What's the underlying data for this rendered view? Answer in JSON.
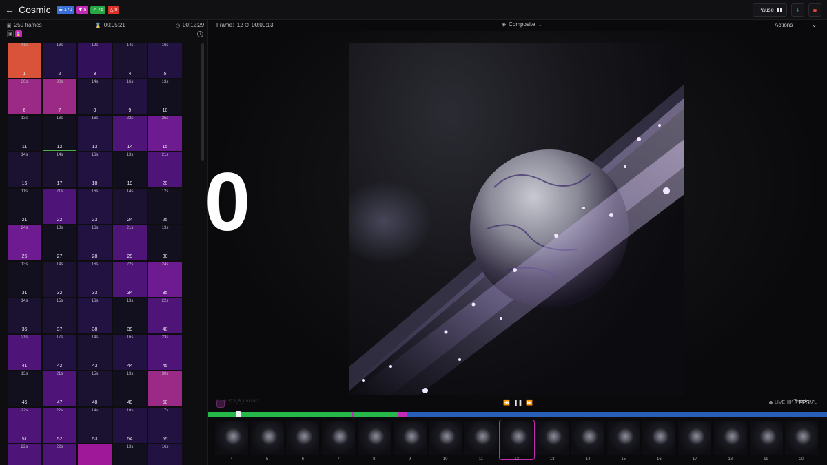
{
  "header": {
    "back_icon": "arrow-left-icon",
    "title": "Cosmic",
    "badges": [
      {
        "icon": "list-icon",
        "value": "170",
        "color": "#3a6fd8"
      },
      {
        "icon": "running-icon",
        "value": "5",
        "color": "#c42bb4"
      },
      {
        "icon": "check-icon",
        "value": "75",
        "color": "#28a745"
      },
      {
        "icon": "warning-icon",
        "value": "0",
        "color": "#d9342b"
      }
    ],
    "pause_label": "Pause",
    "download_icon": "download-icon",
    "delete_icon": "trash-icon"
  },
  "left": {
    "frames_label": "250 frames",
    "elapsed": "00:05:21",
    "remaining": "00:12:29",
    "cells": [
      {
        "n": "1",
        "d": "41s"
      },
      {
        "n": "2",
        "d": "18s"
      },
      {
        "n": "3",
        "d": "19s"
      },
      {
        "n": "4",
        "d": "14s"
      },
      {
        "n": "5",
        "d": "16s"
      },
      {
        "n": "6",
        "d": "30s"
      },
      {
        "n": "7",
        "d": "30s"
      },
      {
        "n": "8",
        "d": "14s"
      },
      {
        "n": "9",
        "d": "16s"
      },
      {
        "n": "10",
        "d": "13s"
      },
      {
        "n": "11",
        "d": "13s"
      },
      {
        "n": "12",
        "d": "13s"
      },
      {
        "n": "13",
        "d": "16s"
      },
      {
        "n": "14",
        "d": "22s"
      },
      {
        "n": "15",
        "d": "25s"
      },
      {
        "n": "16",
        "d": "14s"
      },
      {
        "n": "17",
        "d": "14s"
      },
      {
        "n": "18",
        "d": "16s"
      },
      {
        "n": "19",
        "d": "13s"
      },
      {
        "n": "20",
        "d": "21s"
      },
      {
        "n": "21",
        "d": "11s"
      },
      {
        "n": "22",
        "d": "21s"
      },
      {
        "n": "23",
        "d": "16s"
      },
      {
        "n": "24",
        "d": "14s"
      },
      {
        "n": "25",
        "d": "12s"
      },
      {
        "n": "26",
        "d": "24s"
      },
      {
        "n": "27",
        "d": "13s"
      },
      {
        "n": "28",
        "d": "16s"
      },
      {
        "n": "29",
        "d": "21s"
      },
      {
        "n": "30",
        "d": "13s"
      },
      {
        "n": "31",
        "d": "13s"
      },
      {
        "n": "32",
        "d": "14s"
      },
      {
        "n": "33",
        "d": "16s"
      },
      {
        "n": "34",
        "d": "22s"
      },
      {
        "n": "35",
        "d": "24s"
      },
      {
        "n": "36",
        "d": "14s"
      },
      {
        "n": "37",
        "d": "15s"
      },
      {
        "n": "38",
        "d": "16s"
      },
      {
        "n": "39",
        "d": "13s"
      },
      {
        "n": "40",
        "d": "22s"
      },
      {
        "n": "41",
        "d": "21s"
      },
      {
        "n": "42",
        "d": "17s"
      },
      {
        "n": "43",
        "d": "14s"
      },
      {
        "n": "44",
        "d": "16s"
      },
      {
        "n": "45",
        "d": "23s"
      },
      {
        "n": "46",
        "d": "13s"
      },
      {
        "n": "47",
        "d": "21s"
      },
      {
        "n": "48",
        "d": "15s"
      },
      {
        "n": "49",
        "d": "13s"
      },
      {
        "n": "50",
        "d": "30s"
      },
      {
        "n": "51",
        "d": "22s"
      },
      {
        "n": "52",
        "d": "22s"
      },
      {
        "n": "53",
        "d": "14s"
      },
      {
        "n": "54",
        "d": "16s"
      },
      {
        "n": "55",
        "d": "17s"
      },
      {
        "n": "",
        "d": "22s"
      },
      {
        "n": "",
        "d": "22s"
      },
      {
        "n": "",
        "d": ""
      },
      {
        "n": "",
        "d": "13s"
      },
      {
        "n": "",
        "d": "16s"
      }
    ],
    "selected_frame": "12"
  },
  "overlay": {
    "big_number": "0"
  },
  "viewer": {
    "frame_label": "Frame:",
    "frame_value": "12",
    "frame_time": "00:00:13",
    "view_mode": "Composite",
    "actions_label": "Actions",
    "hint_text": "Hash: 57S_B_C9Y0KJ",
    "task_logs_label": "Task Logs",
    "live_label": "LIVE",
    "fps_label": "15 FPS"
  },
  "timeline": {
    "playhead_fraction": 0.048,
    "segments": [
      {
        "from": 0.0,
        "to": 0.233,
        "color": "#27b84a"
      },
      {
        "from": 0.233,
        "to": 0.236,
        "color": "#c42bb4"
      },
      {
        "from": 0.236,
        "to": 0.307,
        "color": "#27b84a"
      },
      {
        "from": 0.307,
        "to": 0.322,
        "color": "#c42bb4"
      }
    ]
  },
  "strip": {
    "frames": [
      "4",
      "5",
      "6",
      "7",
      "8",
      "9",
      "10",
      "11",
      "12",
      "13",
      "14",
      "15",
      "16",
      "17",
      "18",
      "19",
      "20"
    ],
    "selected": "12"
  }
}
